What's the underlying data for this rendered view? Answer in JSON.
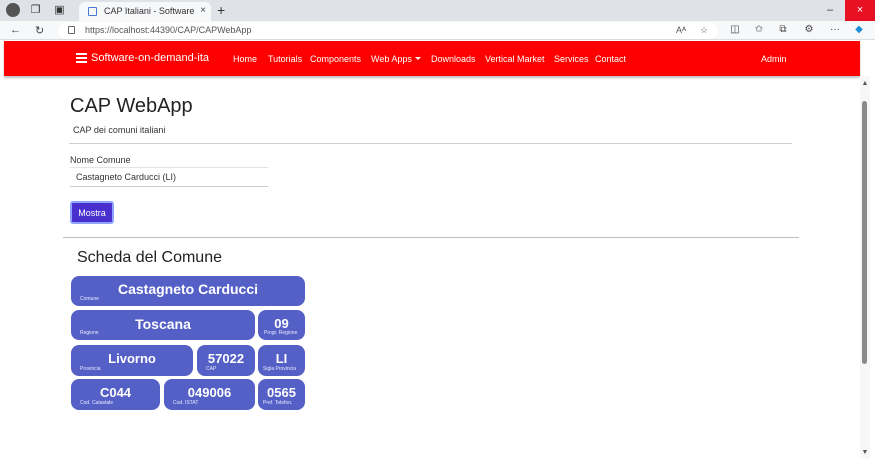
{
  "browser": {
    "tab_title": "CAP Italiani - Software on dema",
    "tab_close": "×",
    "new_tab": "+",
    "url": "https://localhost:44390/CAP/CAPWebApp",
    "win_min": "–",
    "win_max": "☐",
    "win_close": "×",
    "toolbar_icons": [
      "read-aloud-icon",
      "favorite-star-icon",
      "split-screen-icon",
      "favorites-icon",
      "collections-icon",
      "extensions-icon",
      "more-icon",
      "copilot-icon"
    ]
  },
  "navbar": {
    "brand": "Software-on-demand-ita",
    "links": [
      "Home",
      "Tutorials",
      "Components",
      "Web Apps",
      "Downloads",
      "Vertical Market",
      "Services",
      "Contact"
    ],
    "admin": "Admin"
  },
  "page": {
    "title": "CAP WebApp",
    "subtitle": "CAP dei comuni italiani",
    "field_label": "Nome Comune",
    "field_value": "Castagneto Carducci (LI)",
    "button_label": "Mostra",
    "section_title": "Scheda del Comune"
  },
  "cards": {
    "comune": {
      "value": "Castagneto Carducci",
      "caption": "Comune"
    },
    "regione": {
      "value": "Toscana",
      "caption": "Regione"
    },
    "prog_regione": {
      "value": "09",
      "caption": "Progr. Regione"
    },
    "provincia": {
      "value": "Livorno",
      "caption": "Provincia"
    },
    "cap": {
      "value": "57022",
      "caption": "CAP"
    },
    "sigla": {
      "value": "LI",
      "caption": "Sigla Provincia"
    },
    "catastale": {
      "value": "C044",
      "caption": "Cod. Catastale"
    },
    "istat": {
      "value": "049006",
      "caption": "Cod. ISTAT"
    },
    "prefisso": {
      "value": "0565",
      "caption": "Pref. Telefon."
    }
  },
  "colors": {
    "navbar_bg": "#ff0000",
    "card_bg": "#5560c6",
    "button_bg": "#4a2fcf"
  }
}
